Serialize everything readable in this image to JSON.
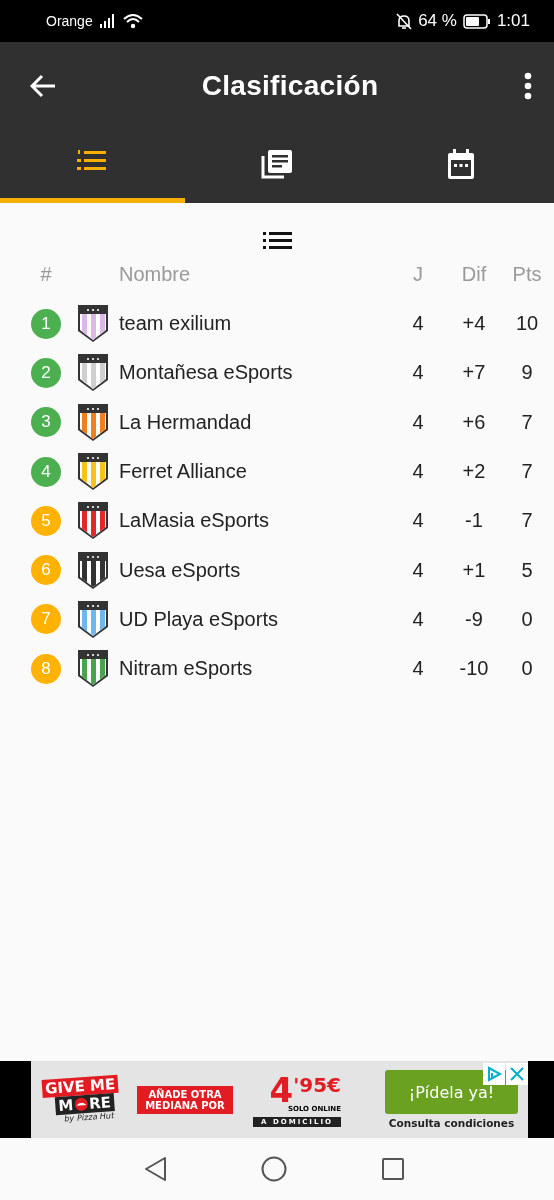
{
  "status_bar": {
    "carrier": "Orange",
    "battery_text": "64 %",
    "time": "1:01"
  },
  "app_bar": {
    "title": "Clasificación"
  },
  "tabs": [
    {
      "kind": "ranking",
      "selected": true
    },
    {
      "kind": "news",
      "selected": false
    },
    {
      "kind": "calendar",
      "selected": false
    }
  ],
  "table": {
    "columns": [
      "#",
      "Nombre",
      "J",
      "Dif",
      "Pts"
    ],
    "rows": [
      {
        "rank": "1",
        "color": "#4caf50",
        "crest": {
          "color": "#dcb8e8"
        },
        "name": "team exilium",
        "j": "4",
        "dif": "+4",
        "pts": "10"
      },
      {
        "rank": "2",
        "color": "#4caf50",
        "crest": {
          "color": "#cfcfcf"
        },
        "name": "Montañesa eSports",
        "j": "4",
        "dif": "+7",
        "pts": "9"
      },
      {
        "rank": "3",
        "color": "#4caf50",
        "crest": {
          "color": "#f07f22"
        },
        "name": "La Hermandad",
        "j": "4",
        "dif": "+6",
        "pts": "7"
      },
      {
        "rank": "4",
        "color": "#4caf50",
        "crest": {
          "color": "#f7c21b"
        },
        "name": "Ferret Alliance",
        "j": "4",
        "dif": "+2",
        "pts": "7"
      },
      {
        "rank": "5",
        "color": "#ffb300",
        "crest": {
          "color": "#e02a2a"
        },
        "name": "LaMasia eSports",
        "j": "4",
        "dif": "-1",
        "pts": "7"
      },
      {
        "rank": "6",
        "color": "#ffb300",
        "crest": {
          "color": "#333333"
        },
        "name": "Uesa eSports",
        "j": "4",
        "dif": "+1",
        "pts": "5"
      },
      {
        "rank": "7",
        "color": "#ffb300",
        "crest": {
          "color": "#6fb6ea"
        },
        "name": "UD Playa eSports",
        "j": "4",
        "dif": "-9",
        "pts": "0"
      },
      {
        "rank": "8",
        "color": "#ffb300",
        "crest": {
          "color": "#4aa34f"
        },
        "name": "Nitram eSports",
        "j": "4",
        "dif": "-10",
        "pts": "0"
      }
    ]
  },
  "ad": {
    "logo_top": "GIVE ME",
    "logo_m": "M",
    "logo_re": "RE",
    "logo_by": "by",
    "logo_brand": "Pizza Hut",
    "offer": "AÑADE OTRA MEDIANA POR",
    "price_big": "4",
    "price_small": "'95€",
    "online": "SOLO ONLINE",
    "delivery": "A DOMICILIO",
    "cta": "¡Pídela ya!",
    "terms": "Consulta condiciones"
  }
}
